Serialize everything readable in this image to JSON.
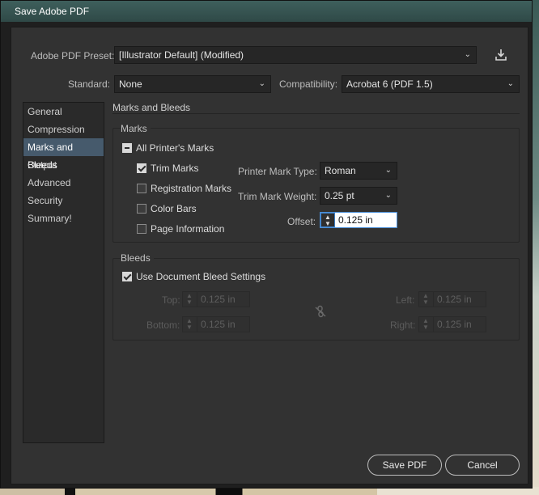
{
  "window": {
    "title": "Save Adobe PDF"
  },
  "preset": {
    "label": "Adobe PDF Preset:",
    "value": "[Illustrator Default] (Modified)"
  },
  "standard": {
    "label": "Standard:",
    "value": "None"
  },
  "compatibility": {
    "label": "Compatibility:",
    "value": "Acrobat 6 (PDF 1.5)"
  },
  "sidebar": {
    "items": [
      {
        "label": "General"
      },
      {
        "label": "Compression"
      },
      {
        "label": "Marks and Bleeds"
      },
      {
        "label": "Output"
      },
      {
        "label": "Advanced"
      },
      {
        "label": "Security"
      },
      {
        "label": "Summary!"
      }
    ],
    "active": "Marks and Bleeds"
  },
  "section": {
    "title": "Marks and Bleeds"
  },
  "marks": {
    "title": "Marks",
    "all_printers_marks": "All Printer's Marks",
    "trim_marks": "Trim Marks",
    "registration_marks": "Registration Marks",
    "color_bars": "Color Bars",
    "page_information": "Page Information",
    "printer_mark_type_label": "Printer Mark Type:",
    "printer_mark_type_value": "Roman",
    "trim_mark_weight_label": "Trim Mark Weight:",
    "trim_mark_weight_value": "0.25 pt",
    "offset_label": "Offset:",
    "offset_value": "0.125 in"
  },
  "bleeds": {
    "title": "Bleeds",
    "use_document": "Use Document Bleed Settings",
    "top_label": "Top:",
    "top_value": "0.125 in",
    "bottom_label": "Bottom:",
    "bottom_value": "0.125 in",
    "left_label": "Left:",
    "left_value": "0.125 in",
    "right_label": "Right:",
    "right_value": "0.125 in"
  },
  "buttons": {
    "save": "Save PDF",
    "cancel": "Cancel"
  },
  "icons": {
    "dropdown": "chevron-down-icon",
    "save_preset": "download-icon",
    "link": "broken-link-icon"
  }
}
